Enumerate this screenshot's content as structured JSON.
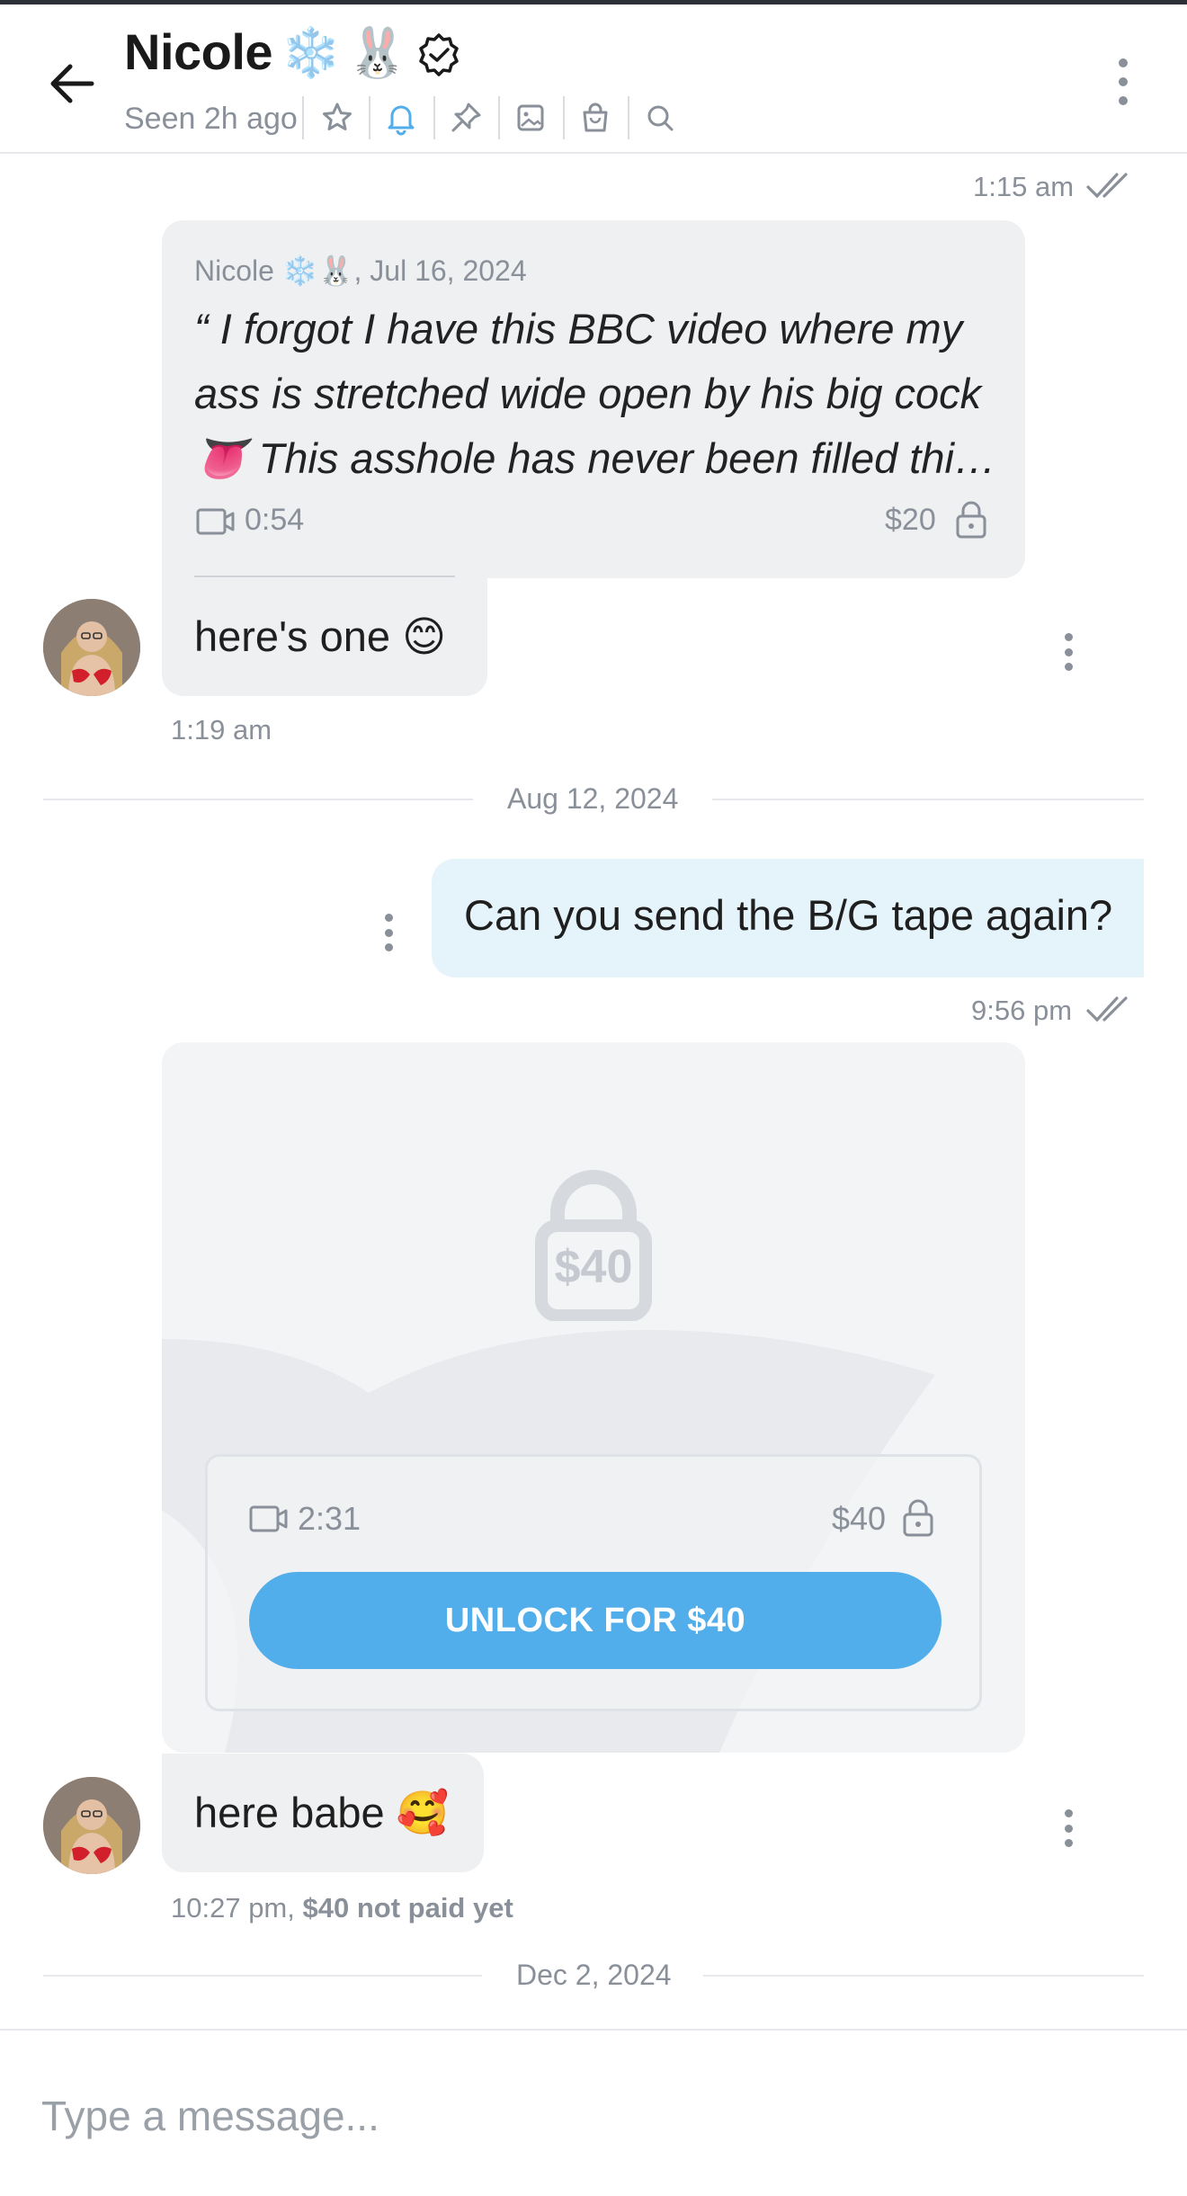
{
  "colors": {
    "accent": "#52aeea",
    "outgoing_bubble": "#e5f3fb",
    "incoming_bubble": "#eff0f2",
    "muted_text": "#8a9099"
  },
  "header": {
    "name": "Nicole",
    "name_emojis": [
      "❄️",
      "🐰"
    ],
    "status": "Seen 2h ago",
    "icons": [
      "star-icon",
      "bell-icon",
      "pin-icon",
      "image-icon",
      "shopping-bag-icon",
      "search-icon"
    ]
  },
  "messages": {
    "m0": {
      "time": "1:15 am"
    },
    "m1": {
      "quote_author": "Nicole ❄️🐰, Jul 16, 2024",
      "quote_lines": [
        "“ I forgot I have this BBC video where my",
        "ass is stretched wide open by his big cock",
        "👅 This asshole has never been filled thi…"
      ],
      "quote_duration": "0:54",
      "quote_price": "$20",
      "text": "here's one 😊",
      "time": "1:19 am"
    },
    "date_divider_1": "Aug 12, 2024",
    "m2": {
      "text": "Can you send the B/G tape again?",
      "time": "9:56 pm"
    },
    "m3": {
      "lock_price": "$40",
      "duration": "2:31",
      "price": "$40",
      "unlock_label": "UNLOCK FOR $40",
      "text": "here babe 🥰",
      "time": "10:27 pm,",
      "paid_status": "$40 not paid yet"
    },
    "date_divider_2": "Dec 2, 2024"
  },
  "composer": {
    "placeholder": "Type a message..."
  }
}
